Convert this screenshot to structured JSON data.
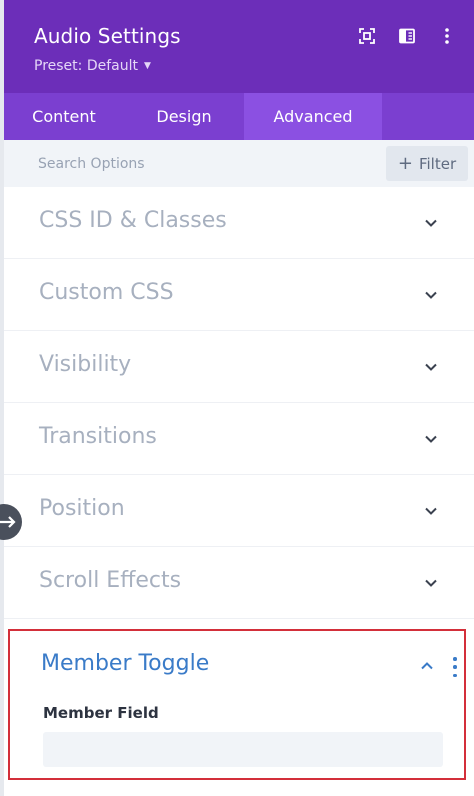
{
  "header": {
    "title": "Audio Settings",
    "preset_label": "Preset: Default",
    "background_color": "#6c2eb9",
    "icons": [
      "fullscreen-icon",
      "split-view-icon",
      "more-vertical-icon"
    ]
  },
  "tabs": [
    {
      "label": "Content",
      "active": false
    },
    {
      "label": "Design",
      "active": false
    },
    {
      "label": "Advanced",
      "active": true
    }
  ],
  "search": {
    "placeholder": "Search Options",
    "filter_label": "Filter"
  },
  "sections": [
    {
      "label": "CSS ID & Classes",
      "expanded": false
    },
    {
      "label": "Custom CSS",
      "expanded": false
    },
    {
      "label": "Visibility",
      "expanded": false
    },
    {
      "label": "Transitions",
      "expanded": false
    },
    {
      "label": "Position",
      "expanded": false
    },
    {
      "label": "Scroll Effects",
      "expanded": false
    }
  ],
  "member_toggle": {
    "title": "Member Toggle",
    "expanded": true,
    "field_label": "Member Field",
    "field_value": "",
    "highlight_color": "#d32f3a",
    "title_color": "#3a7bc8"
  }
}
